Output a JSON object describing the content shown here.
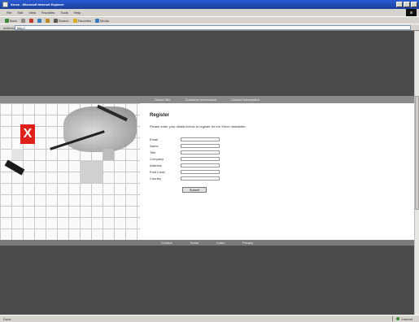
{
  "window": {
    "title": "Xerox - Microsoft Internet Explorer"
  },
  "menubar": {
    "items": [
      "File",
      "Edit",
      "View",
      "Favorites",
      "Tools",
      "Help"
    ]
  },
  "toolbar": {
    "items": [
      {
        "label": "Back",
        "icon": "back-icon",
        "color": "#3a8a3a"
      },
      {
        "label": "",
        "icon": "forward-icon",
        "color": "#8a8a8a"
      },
      {
        "label": "",
        "icon": "stop-icon",
        "color": "#c0392b"
      },
      {
        "label": "",
        "icon": "refresh-icon",
        "color": "#3a7ac0"
      },
      {
        "label": "",
        "icon": "home-icon",
        "color": "#c08a2a"
      },
      {
        "label": "Search",
        "icon": "search-icon",
        "color": "#5a5a5a"
      },
      {
        "label": "Favorites",
        "icon": "favorites-icon",
        "color": "#d4b020"
      },
      {
        "label": "Media",
        "icon": "media-icon",
        "color": "#3a7ac0"
      }
    ]
  },
  "address": {
    "label": "Address",
    "url": "http://"
  },
  "site": {
    "topnav": [
      "Global Site",
      "Customer Information",
      "Contact Information"
    ],
    "form": {
      "title": "Register",
      "intro": "Please enter your details below to register for the Xerox newsletter.",
      "fields": [
        {
          "label": "Email",
          "value": ""
        },
        {
          "label": "Name",
          "value": ""
        },
        {
          "label": "Title",
          "value": ""
        },
        {
          "label": "Company",
          "value": ""
        },
        {
          "label": "Address",
          "value": ""
        },
        {
          "label": "Post Code",
          "value": ""
        },
        {
          "label": "Country",
          "value": ""
        }
      ],
      "submit_label": "Submit"
    },
    "footer_links": [
      "Contact",
      "Home",
      "Index",
      "Privacy"
    ]
  },
  "status": {
    "text": "Done",
    "zone": "Internet"
  },
  "colors": {
    "brand_red": "#e0201a",
    "page_dark": "#4b4b4b",
    "nav_grey": "#8a8a8a"
  }
}
